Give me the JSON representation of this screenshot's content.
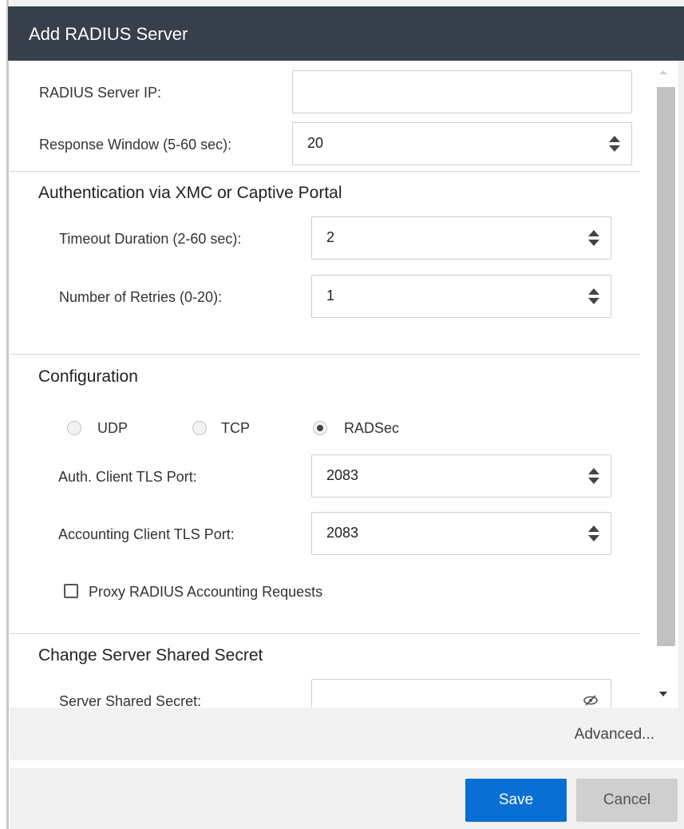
{
  "dialog": {
    "title": "Add RADIUS Server"
  },
  "server": {
    "ip_label": "RADIUS Server IP:",
    "ip_value": "",
    "response_label": "Response Window (5-60 sec):",
    "response_value": "20"
  },
  "auth_section": {
    "heading": "Authentication via XMC or Captive Portal",
    "timeout_label": "Timeout Duration (2-60 sec):",
    "timeout_value": "2",
    "retries_label": "Number of Retries (0-20):",
    "retries_value": "1"
  },
  "config_section": {
    "heading": "Configuration",
    "protocols": [
      {
        "label": "UDP",
        "selected": false
      },
      {
        "label": "TCP",
        "selected": false
      },
      {
        "label": "RADSec",
        "selected": true
      }
    ],
    "auth_port_label": "Auth. Client TLS Port:",
    "auth_port_value": "2083",
    "acct_port_label": "Accounting Client TLS Port:",
    "acct_port_value": "2083",
    "proxy_label": "Proxy RADIUS Accounting Requests",
    "proxy_checked": false
  },
  "secret_section": {
    "heading": "Change Server Shared Secret",
    "secret_label": "Server Shared Secret:",
    "secret_value": ""
  },
  "footer": {
    "advanced_label": "Advanced...",
    "save_label": "Save",
    "cancel_label": "Cancel"
  },
  "colors": {
    "title_bar": "#363f4a",
    "save_button": "#0a6fd3",
    "cancel_button": "#cfcfcf"
  },
  "icons": [
    "spinner-up-icon",
    "spinner-down-icon",
    "eye-slash-icon",
    "scroll-up-icon",
    "scroll-down-icon"
  ]
}
